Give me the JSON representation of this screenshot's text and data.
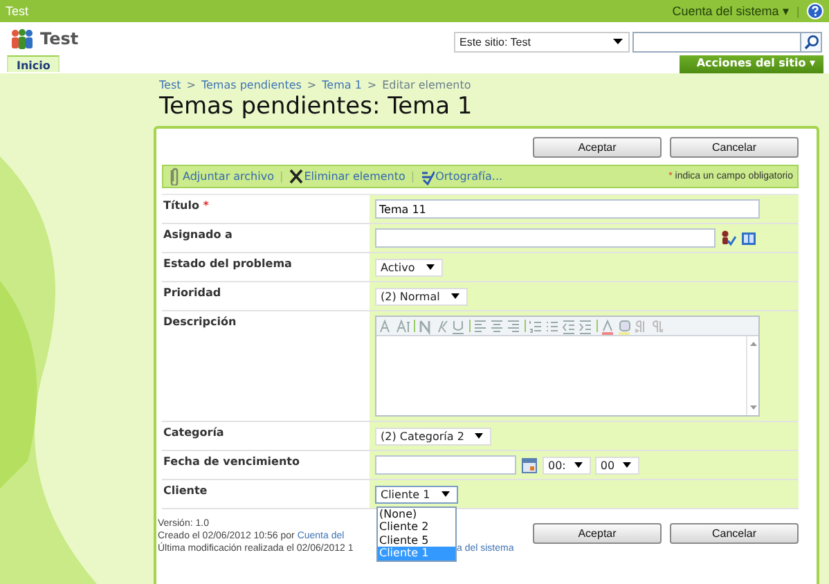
{
  "top_bar": {
    "title": "Test",
    "account": "Cuenta del sistema",
    "account_caret": "▾",
    "separator": "|"
  },
  "header": {
    "site_title": "Test",
    "search_scope": "Este sitio: Test"
  },
  "tabs": [
    {
      "label": "Inicio",
      "selected": true
    }
  ],
  "site_actions": {
    "label": "Acciones del sitio",
    "caret": "▾"
  },
  "breadcrumb": [
    {
      "label": "Test",
      "link": true
    },
    {
      "label": "Temas pendientes",
      "link": true
    },
    {
      "label": "Tema 1",
      "link": true
    },
    {
      "label": "Editar elemento",
      "link": false
    }
  ],
  "breadcrumb_separator": ">",
  "page_title": "Temas pendientes: Tema 1",
  "top_buttons": [
    "Aceptar",
    "Cancelar"
  ],
  "toolbar": {
    "items": [
      {
        "kind": "attach",
        "label": "Adjuntar archivo"
      },
      {
        "kind": "delete",
        "label": "Eliminar elemento"
      },
      {
        "kind": "spell",
        "label": "Ortografía..."
      }
    ],
    "separator": "|",
    "required_mark": "*",
    "required_note": "indica un campo obligatorio"
  },
  "fields": [
    {
      "kind": "text",
      "label": "Título",
      "required_mark": "*",
      "value": "Tema 11"
    },
    {
      "kind": "people",
      "label": "Asignado a"
    },
    {
      "kind": "select",
      "label": "Estado del problema",
      "value": "Activo"
    },
    {
      "kind": "select",
      "label": "Prioridad",
      "value": "(2) Normal"
    },
    {
      "kind": "richtext",
      "label": "Descripción"
    },
    {
      "kind": "select",
      "label": "Categoría",
      "value": "(2) Categoría 2"
    },
    {
      "kind": "date",
      "label": "Fecha de vencimiento",
      "hour": "00:",
      "minute": "00"
    },
    {
      "kind": "select",
      "label": "Cliente",
      "value": "Cliente 1",
      "expanded": true,
      "options": [
        {
          "label": "(None)",
          "selected": false
        },
        {
          "label": "Cliente 2",
          "selected": false
        },
        {
          "label": "Cliente 5",
          "selected": false
        },
        {
          "label": "Cliente 1",
          "selected": true
        }
      ]
    }
  ],
  "footer": {
    "version": "Versión: 1.0",
    "created": "Creado el 02/06/2012 10:56  por",
    "created_link": "Cuenta del",
    "modified": "Última modificación realizada el 02/06/2012 1",
    "modified_link": "a del sistema"
  },
  "bottom_buttons": [
    "Aceptar",
    "Cancelar"
  ]
}
